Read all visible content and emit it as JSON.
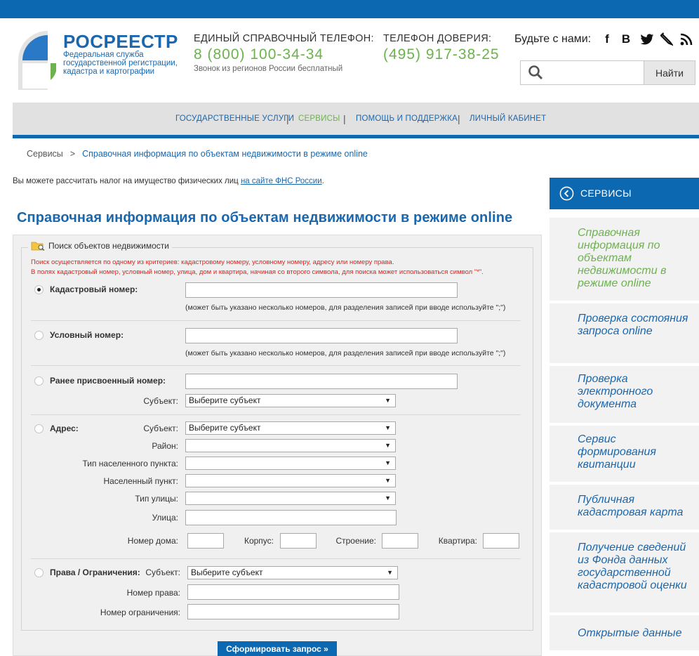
{
  "colors": {
    "brand_blue": "#0c68b1",
    "accent_green": "#6cb24f",
    "error_red": "#e0201b"
  },
  "header": {
    "logo_title": "РОСРЕЕСТР",
    "logo_sub": "Федеральная служба государственной регистрации, кадастра и картографии",
    "hotline_title": "ЕДИНЫЙ СПРАВОЧНЫЙ ТЕЛЕФОН:",
    "hotline_number": "8 (800) 100-34-34",
    "hotline_note": "Звонок из регионов России бесплатный",
    "trust_title": "ТЕЛЕФОН ДОВЕРИЯ:",
    "trust_number": "(495) 917-38-25",
    "social_label": "Будьте с нами:",
    "social": [
      "facebook-icon",
      "vk-icon",
      "twitter-icon",
      "livejournal-icon",
      "rss-icon"
    ],
    "search_placeholder": "",
    "search_button": "Найти"
  },
  "nav": {
    "items": [
      {
        "label": "ГОСУДАРСТВЕННЫЕ УСЛУГИ",
        "active": false
      },
      {
        "label": "СЕРВИСЫ",
        "active": true
      },
      {
        "label": "ПОМОЩЬ И ПОДДЕРЖКА",
        "active": false
      },
      {
        "label": "ЛИЧНЫЙ КАБИНЕТ",
        "active": false
      }
    ],
    "separator": "|"
  },
  "breadcrumb": {
    "root": "Сервисы",
    "sep": ">",
    "current": "Справочная информация по объектам недвижимости в режиме online"
  },
  "tax_note": {
    "text": "Вы можете рассчитать налог на имущество физических лиц ",
    "link": "на сайте ФНС России",
    "end": "."
  },
  "page_title": "Справочная информация по объектам недвижимости в режиме online",
  "form": {
    "legend": "Поиск объектов недвижимости",
    "hint1": "Поиск осуществляется по одному из критериев: кадастровому номеру, условному номеру, адресу или номеру права.",
    "hint2": "В полях кадастровый номер, условный номер, улица, дом и квартира, начиная со второго символа, для поиска может использоваться символ \"*\".",
    "cadastral_label": "Кадастровый номер:",
    "cadastral_note": "(может быть указано несколько номеров, для разделения записей при вводе используйте \";\")",
    "conditional_label": "Условный номер:",
    "conditional_note": "(может быть указано несколько номеров, для разделения записей при вводе используйте \";\")",
    "previous_label": "Ранее присвоенный номер:",
    "subject_label": "Субъект:",
    "subject_placeholder": "Выберите субъект",
    "address_label": "Адрес:",
    "district_label": "Район:",
    "settlement_type_label": "Тип населенного пункта:",
    "settlement_label": "Населенный пункт:",
    "street_type_label": "Тип улицы:",
    "street_label": "Улица:",
    "house_label": "Номер дома:",
    "building_label": "Корпус:",
    "structure_label": "Строение:",
    "apartment_label": "Квартира:",
    "rights_label": "Права / Ограничения:",
    "right_number_label": "Номер права:",
    "restriction_number_label": "Номер ограничения:",
    "submit": "Сформировать запрос »",
    "selected_criterion": "cadastral"
  },
  "sidebar": {
    "title": "СЕРВИСЫ",
    "items": [
      {
        "label": "Справочная информация по объектам недвижимости в режиме online",
        "active": true
      },
      {
        "label": "Проверка состояния запроса online",
        "active": false
      },
      {
        "label": "Проверка электронного документа",
        "active": false
      },
      {
        "label": "Сервис формирования квитанции",
        "active": false
      },
      {
        "label": "Публичная кадастровая карта",
        "active": false
      },
      {
        "label": "Получение сведений из Фонда данных государственной кадастровой оценки",
        "active": false
      },
      {
        "label": "Открытые данные",
        "active": false
      }
    ]
  }
}
